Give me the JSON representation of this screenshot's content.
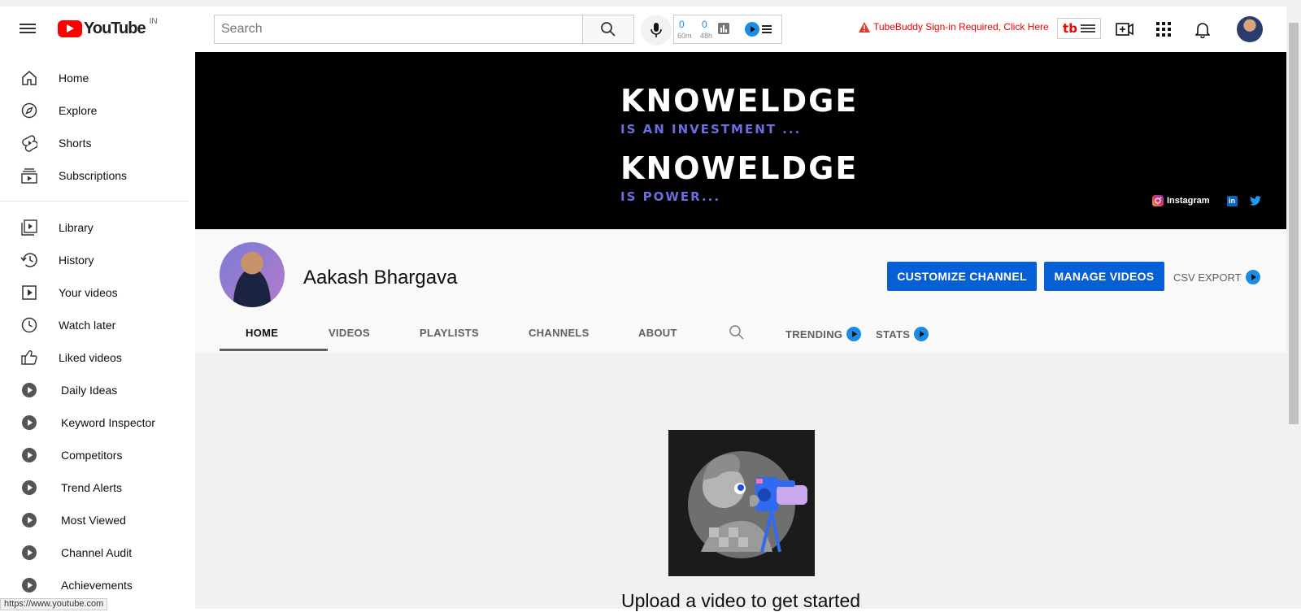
{
  "header": {
    "logo_text": "YouTube",
    "region": "IN",
    "search_placeholder": "Search",
    "tb_stats": {
      "views_value": "0",
      "views_label": "60m",
      "subs_value": "0",
      "subs_label": "48h"
    },
    "tb_warning": "TubeBuddy Sign-in Required, Click Here",
    "icons": [
      "menu-icon",
      "search-icon",
      "mic-icon",
      "create-icon",
      "apps-icon",
      "bell-icon",
      "avatar"
    ]
  },
  "sidebar": {
    "primary": [
      {
        "label": "Home",
        "icon": "home-icon"
      },
      {
        "label": "Explore",
        "icon": "compass-icon"
      },
      {
        "label": "Shorts",
        "icon": "shorts-icon"
      },
      {
        "label": "Subscriptions",
        "icon": "subscriptions-icon"
      }
    ],
    "secondary": [
      {
        "label": "Library",
        "icon": "library-icon"
      },
      {
        "label": "History",
        "icon": "history-icon"
      },
      {
        "label": "Your videos",
        "icon": "your-videos-icon"
      },
      {
        "label": "Watch later",
        "icon": "clock-icon"
      },
      {
        "label": "Liked videos",
        "icon": "thumbs-up-icon"
      },
      {
        "label": "Daily Ideas",
        "icon": "tubebuddy-icon"
      },
      {
        "label": "Keyword Inspector",
        "icon": "tubebuddy-icon"
      },
      {
        "label": "Competitors",
        "icon": "tubebuddy-icon"
      },
      {
        "label": "Trend Alerts",
        "icon": "tubebuddy-icon"
      },
      {
        "label": "Most Viewed",
        "icon": "tubebuddy-icon"
      },
      {
        "label": "Channel Audit",
        "icon": "tubebuddy-icon"
      },
      {
        "label": "Achievements",
        "icon": "tubebuddy-icon"
      }
    ]
  },
  "status_url": "https://www.youtube.com",
  "banner": {
    "line1": "KNOWELDGE",
    "line2": "IS AN INVESTMENT ...",
    "line3": "KNOWELDGE",
    "line4": "IS POWER...",
    "instagram": "Instagram"
  },
  "channel": {
    "name": "Aakash Bhargava",
    "customize_label": "CUSTOMIZE CHANNEL",
    "manage_label": "MANAGE VIDEOS",
    "csv_label": "CSV EXPORT",
    "tabs": [
      "HOME",
      "VIDEOS",
      "PLAYLISTS",
      "CHANNELS",
      "ABOUT",
      "TRENDING",
      "STATS"
    ],
    "active_tab": "HOME"
  },
  "empty_state": {
    "message": "Upload a video to get started"
  },
  "colors": {
    "brand_red": "#ff0000",
    "accent_blue": "#065fd4",
    "tubebuddy_blue": "#1a8ce8",
    "banner_purple": "#6b6de0"
  }
}
